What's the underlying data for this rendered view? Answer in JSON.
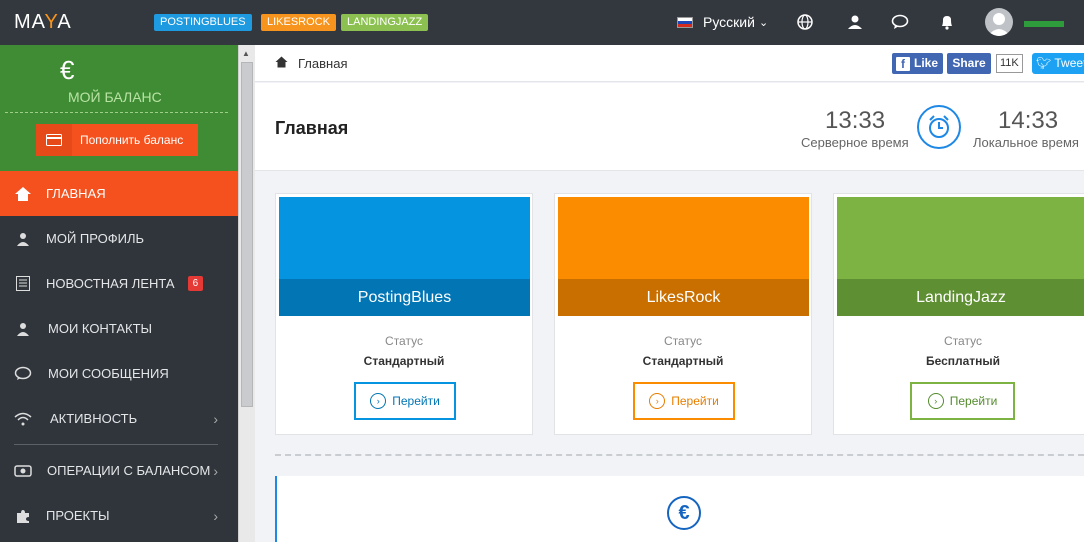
{
  "topbar": {
    "logo_left": "MA",
    "logo_accent": "Y",
    "logo_right": "A",
    "tags": [
      {
        "label": "POSTINGBLUES",
        "color": "#1e9ae0"
      },
      {
        "label": "LIKESROCK",
        "color": "#f7941d"
      },
      {
        "label": "LANDINGJAZZ",
        "color": "#8cc152"
      }
    ],
    "language": "Русский",
    "icons": [
      "globe-icon",
      "user-icon",
      "chat-icon",
      "bell-icon"
    ]
  },
  "sidebar": {
    "currency_symbol": "€",
    "balance_label": "МОЙ БАЛАНС",
    "topup_label": "Пополнить баланс",
    "items": [
      {
        "label": "ГЛАВНАЯ",
        "icon": "home-icon",
        "active": true
      },
      {
        "label": "МОЙ ПРОФИЛЬ",
        "icon": "user-icon"
      },
      {
        "label": "НОВОСТНАЯ ЛЕНТА",
        "icon": "newspaper-icon",
        "badge": "6"
      },
      {
        "label": "МОИ КОНТАКТЫ",
        "icon": "contact-icon"
      },
      {
        "label": "МОИ СООБЩЕНИЯ",
        "icon": "chat-icon"
      },
      {
        "label": "АКТИВНОСТЬ",
        "icon": "wifi-icon"
      },
      {
        "label": "ОПЕРАЦИИ С БАЛАНСОМ",
        "icon": "wallet-icon"
      },
      {
        "label": "ПРОЕКТЫ",
        "icon": "puzzle-icon"
      }
    ]
  },
  "breadcrumb": {
    "label": "Главная"
  },
  "social": {
    "like": "Like",
    "share": "Share",
    "count": "11K",
    "tweet": "Tweet"
  },
  "header": {
    "title": "Главная",
    "server_time": "13:33",
    "server_label": "Серверное время",
    "local_time": "14:33",
    "local_label": "Локальное время"
  },
  "projects": [
    {
      "name": "PostingBlues",
      "status_label": "Статус",
      "status": "Стандартный",
      "button": "Перейти",
      "color": "#0494e0",
      "band": "#0275b5"
    },
    {
      "name": "LikesRock",
      "status_label": "Статус",
      "status": "Стандартный",
      "button": "Перейти",
      "color": "#fb8c00",
      "band": "#c96f00"
    },
    {
      "name": "LandingJazz",
      "status_label": "Статус",
      "status": "Бесплатный",
      "button": "Перейти",
      "color": "#7cb342",
      "band": "#5f8f33"
    }
  ],
  "bottom": {
    "currency_symbol": "€"
  }
}
